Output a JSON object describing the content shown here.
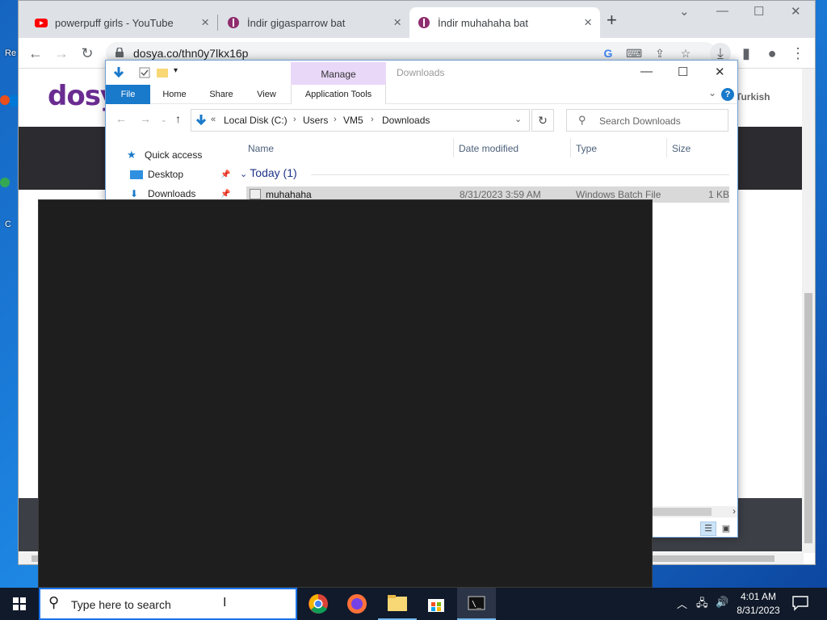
{
  "desktop": {
    "icon_label_1": "Re",
    "icon_label_2": "C"
  },
  "browser": {
    "tabs": [
      {
        "title": "powerpuff girls - YouTube",
        "icon": "youtube-icon"
      },
      {
        "title": "İndir gigasparrow bat",
        "icon": "dosya-icon"
      },
      {
        "title": "İndir muhahaha bat",
        "icon": "dosya-icon"
      }
    ],
    "url": "dosya.co/thn0y7lkx16p",
    "page": {
      "logo_text": "dosy",
      "lang": "Turkish"
    }
  },
  "explorer": {
    "manage_label": "Manage",
    "title": "Downloads",
    "ribbon_tabs": [
      "File",
      "Home",
      "Share",
      "View",
      "Application Tools"
    ],
    "breadcrumb": [
      "Local Disk (C:)",
      "Users",
      "VM5",
      "Downloads"
    ],
    "breadcrumb_prefix": "«",
    "search_placeholder": "Search Downloads",
    "nav": [
      {
        "label": "Quick access"
      },
      {
        "label": "Desktop"
      },
      {
        "label": "Downloads"
      }
    ],
    "columns": [
      "Name",
      "Date modified",
      "Type",
      "Size"
    ],
    "group_label": "Today (1)",
    "files": [
      {
        "name": "muhahaha",
        "modified": "8/31/2023 3:59 AM",
        "type": "Windows Batch File",
        "size": "1 KB"
      }
    ]
  },
  "taskbar": {
    "search_placeholder": "Type here to search",
    "time": "4:01 AM",
    "date": "8/31/2023"
  },
  "colors": {
    "accent": "#1979ca",
    "manage": "#e9d8f8",
    "console": "#1e1e1e",
    "brand": "#6a2c91"
  }
}
